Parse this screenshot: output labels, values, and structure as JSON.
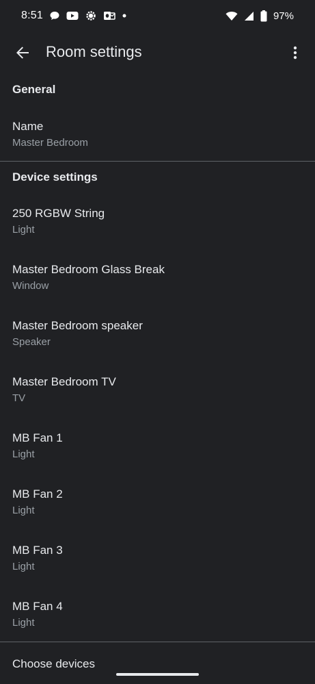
{
  "status_bar": {
    "time": "8:51",
    "battery": "97%",
    "left_icons": [
      "chat-bubble-icon",
      "youtube-icon",
      "settings-gear-icon",
      "outlook-icon",
      "dot-icon"
    ],
    "right_icons": [
      "wifi-icon",
      "cell-signal-icon",
      "battery-icon"
    ]
  },
  "app_bar": {
    "title": "Room settings"
  },
  "general": {
    "header": "General",
    "name_label": "Name",
    "name_value": "Master Bedroom"
  },
  "devices": {
    "header": "Device settings",
    "items": [
      {
        "name": "250 RGBW String",
        "type": "Light"
      },
      {
        "name": "Master Bedroom Glass Break",
        "type": "Window"
      },
      {
        "name": "Master Bedroom speaker",
        "type": "Speaker"
      },
      {
        "name": "Master Bedroom TV",
        "type": "TV"
      },
      {
        "name": "MB Fan 1",
        "type": "Light"
      },
      {
        "name": "MB Fan 2",
        "type": "Light"
      },
      {
        "name": "MB Fan 3",
        "type": "Light"
      },
      {
        "name": "MB Fan 4",
        "type": "Light"
      }
    ]
  },
  "footer": {
    "choose_devices": "Choose devices"
  }
}
